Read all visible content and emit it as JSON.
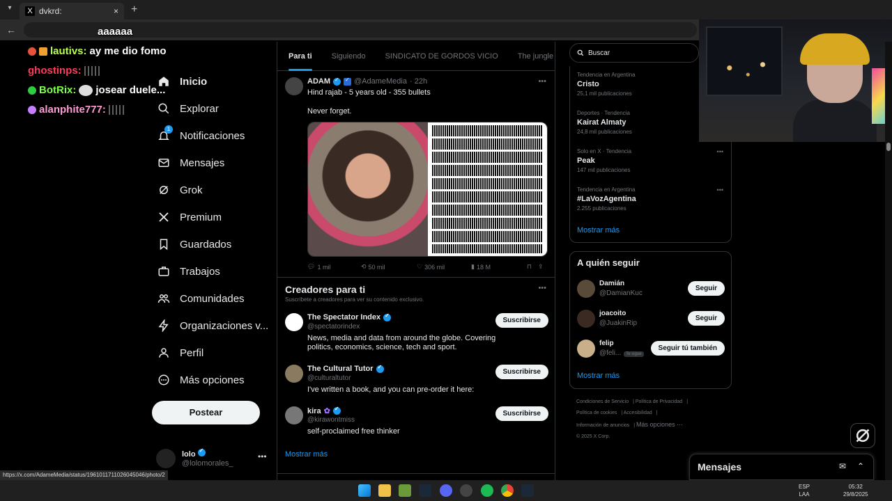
{
  "browser": {
    "tab_title": "dvkrd:",
    "tab_favicon": "x-logo",
    "close_tab": "×",
    "new_tab": "+",
    "back": "←",
    "status_url": "https://x.com/AdameMedia/status/1961011711026045046/photo/2"
  },
  "chat": {
    "lines": [
      {
        "user": "",
        "text": "aaaaaa",
        "color": "#ffffff"
      },
      {
        "user": "lautivs:",
        "text": "ay me dio fomo",
        "color": "#b6ff4a"
      },
      {
        "user": "ghostinps:",
        "text": "",
        "color": "#ff3b5c"
      },
      {
        "user": "BotRix:",
        "text": "josear duele...",
        "color": "#7cff4a"
      },
      {
        "user": "alanphite777:",
        "text": "",
        "color": "#ff4aa0"
      }
    ]
  },
  "nav": {
    "items": [
      {
        "label": "Inicio",
        "icon": "home-icon"
      },
      {
        "label": "Explorar",
        "icon": "search-icon"
      },
      {
        "label": "Notificaciones",
        "icon": "bell-icon",
        "badge": "1"
      },
      {
        "label": "Mensajes",
        "icon": "mail-icon"
      },
      {
        "label": "Grok",
        "icon": "grok-icon"
      },
      {
        "label": "Premium",
        "icon": "x-icon"
      },
      {
        "label": "Guardados",
        "icon": "bookmark-icon"
      },
      {
        "label": "Trabajos",
        "icon": "briefcase-icon"
      },
      {
        "label": "Comunidades",
        "icon": "people-icon"
      },
      {
        "label": "Organizaciones v...",
        "icon": "bolt-icon"
      },
      {
        "label": "Perfil",
        "icon": "person-icon"
      },
      {
        "label": "Más opciones",
        "icon": "more-circle-icon"
      }
    ],
    "post_button": "Postear",
    "profile": {
      "name": "lolo",
      "handle": "@lolomorales_",
      "more": "•••"
    }
  },
  "main": {
    "tabs": [
      "Para ti",
      "Siguiendo",
      "SINDICATO DE GORDOS VICIO",
      "The jungle"
    ],
    "tweet": {
      "name": "ADAM",
      "handle": "@AdameMedia",
      "time": "· 22h",
      "text": "Hind rajab - 5 years old - 355 bullets",
      "text2": "Never forget.",
      "replies": "1 mil",
      "retweets": "50 mil",
      "likes": "306 mil",
      "views": "18 M"
    },
    "creators": {
      "title": "Creadores para ti",
      "subtitle": "Suscríbete a creadores para ver su contenido exclusivo.",
      "items": [
        {
          "name": "The Spectator Index",
          "handle": "@spectatorindex",
          "bio": "News, media and data from around the globe. Covering politics, economics, science, tech and sport.",
          "button": "Suscribirse"
        },
        {
          "name": "The Cultural Tutor",
          "handle": "@culturaltutor",
          "bio": "I've written a book, and you can pre-order it here:",
          "button": "Suscribirse"
        },
        {
          "name": "kira",
          "handle": "@kirawontmiss",
          "bio": "self-proclaimed free thinker",
          "button": "Suscribirse"
        }
      ],
      "more": "Mostrar más"
    }
  },
  "right": {
    "search_placeholder": "Buscar",
    "trends": [
      {
        "meta": "Tendencia en Argentina",
        "name": "Cristo",
        "count": "25,1 mil publicaciones"
      },
      {
        "meta": "Deportes · Tendencia",
        "name": "Kairat Almaty",
        "count": "24,8 mil publicaciones"
      },
      {
        "meta": "Solo en X · Tendencia",
        "name": "Peak",
        "count": "147 mil publicaciones"
      },
      {
        "meta": "Tendencia en Argentina",
        "name": "#LaVozAgentina",
        "count": "2.255 publicaciones"
      }
    ],
    "trends_more": "Mostrar más",
    "who_title": "A quién seguir",
    "who": [
      {
        "name": "Damián",
        "handle": "@DamianKuc",
        "button": "Seguir",
        "tag": ""
      },
      {
        "name": "joacoito",
        "handle": "@JuakinRip",
        "button": "Seguir",
        "tag": ""
      },
      {
        "name": "felip",
        "handle": "@feli...",
        "button": "Seguir tú también",
        "tag": "Te sigue"
      }
    ],
    "who_more": "Mostrar más",
    "footer": [
      "Condiciones de Servicio",
      "Política de Privacidad",
      "Política de cookies",
      "Accesibilidad",
      "Información de anuncios",
      "Más opciones ···",
      "© 2025 X Corp."
    ]
  },
  "messages_dock": {
    "label": "Mensajes"
  },
  "taskbar": {
    "lang1": "ESP",
    "lang2": "LAA",
    "time": "05:32",
    "date": "29/8/2025"
  },
  "colors": {
    "accent": "#1d9bf0",
    "background": "#000000",
    "border": "#2f3336",
    "muted": "#71767b"
  }
}
